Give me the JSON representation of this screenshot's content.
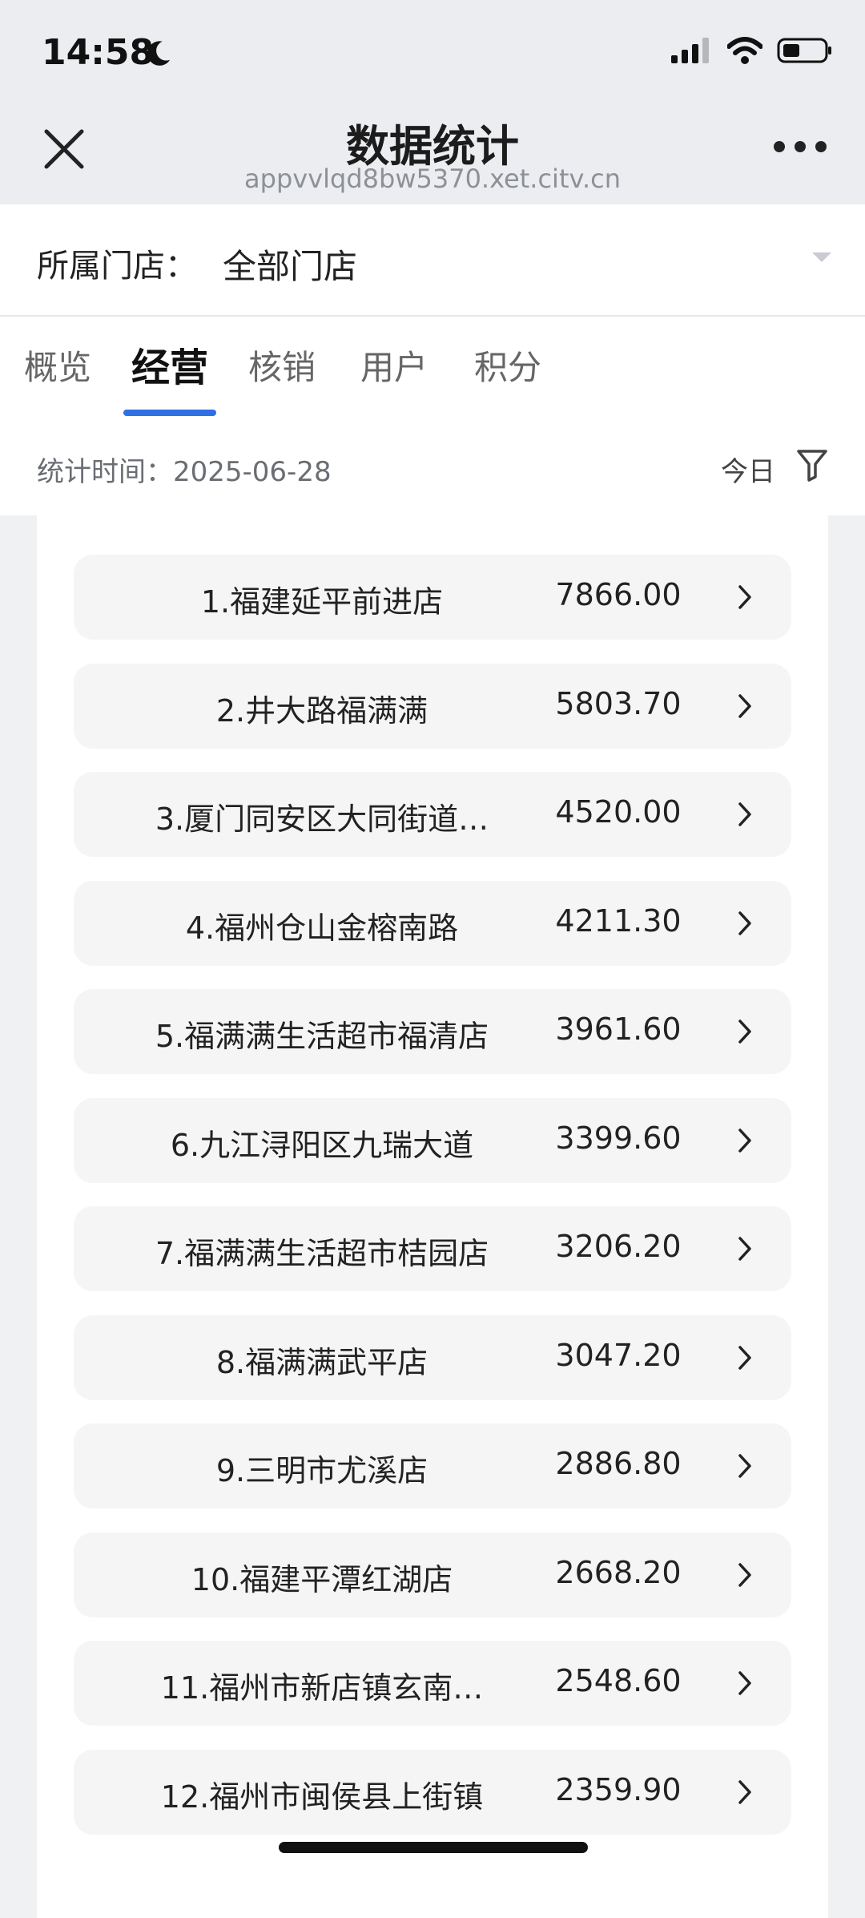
{
  "status_bar": {
    "time": "14:58"
  },
  "nav": {
    "title": "数据统计",
    "url": "appvvlqd8bw5370.xet.citv.cn"
  },
  "store": {
    "label": "所属门店：",
    "value": "全部门店"
  },
  "tabs": [
    {
      "label": "概览"
    },
    {
      "label": "经营"
    },
    {
      "label": "核销"
    },
    {
      "label": "用户"
    },
    {
      "label": "积分"
    }
  ],
  "active_tab": "经营",
  "stats": {
    "date_label": "统计时间：2025-06-28",
    "period": "今日"
  },
  "ranking": [
    {
      "name": "1.福建延平前进店",
      "value": "7866.00"
    },
    {
      "name": "2.井大路福满满",
      "value": "5803.70"
    },
    {
      "name": "3.厦门同安区大同街道…",
      "value": "4520.00"
    },
    {
      "name": "4.福州仓山金榕南路",
      "value": "4211.30"
    },
    {
      "name": "5.福满满生活超市福清店",
      "value": "3961.60"
    },
    {
      "name": "6.九江浔阳区九瑞大道",
      "value": "3399.60"
    },
    {
      "name": "7.福满满生活超市桔园店",
      "value": "3206.20"
    },
    {
      "name": "8.福满满武平店",
      "value": "3047.20"
    },
    {
      "name": "9.三明市尤溪店",
      "value": "2886.80"
    },
    {
      "name": "10.福建平潭红湖店",
      "value": "2668.20"
    },
    {
      "name": "11.福州市新店镇玄南…",
      "value": "2548.60"
    },
    {
      "name": "12.福州市闽侯县上街镇",
      "value": "2359.90"
    }
  ],
  "colors": {
    "accent": "#2f6fe4",
    "row_bg": "#f5f5f6",
    "page_bg": "#f0f1f3"
  }
}
